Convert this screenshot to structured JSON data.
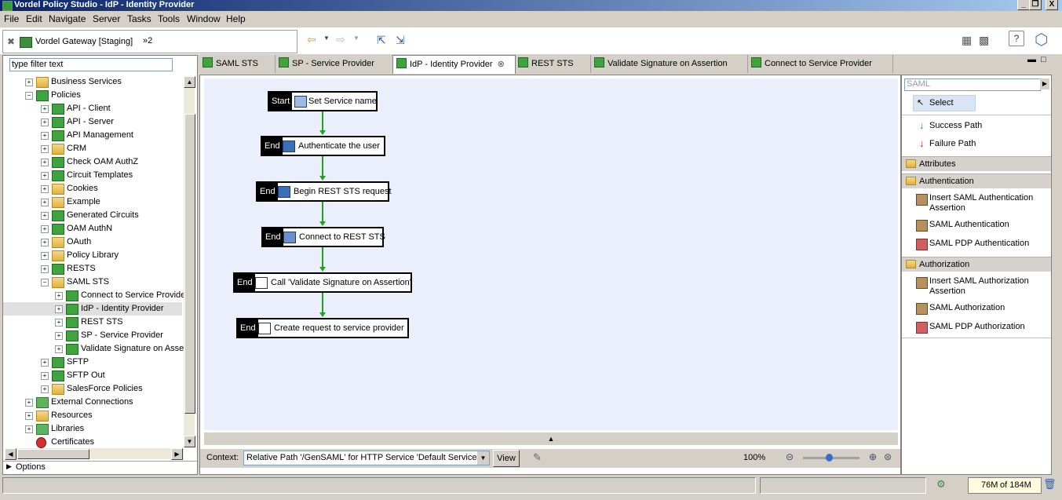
{
  "window": {
    "title": "Vordel Policy Studio - IdP - Identity Provider",
    "controls": [
      "_",
      "❐",
      "X"
    ]
  },
  "menu": [
    "File",
    "Edit",
    "Navigate",
    "Server",
    "Tasks",
    "Tools",
    "Window",
    "Help"
  ],
  "toolbar": {
    "gateway_label": "Vordel Gateway [Staging]",
    "gateway_suffix": "»2"
  },
  "tree": {
    "filter_placeholder": "type filter text",
    "rows": [
      {
        "label": "Business Services",
        "level": 1,
        "icon": "folder-icon"
      },
      {
        "label": "Policies",
        "level": 1,
        "icon": "policy-icon",
        "expanded": true
      },
      {
        "label": "API - Client",
        "level": 2,
        "icon": "policy-icon"
      },
      {
        "label": "API - Server",
        "level": 2,
        "icon": "policy-icon"
      },
      {
        "label": "API Management",
        "level": 2,
        "icon": "policy-icon"
      },
      {
        "label": "CRM",
        "level": 2,
        "icon": "folder-icon"
      },
      {
        "label": "Check OAM AuthZ",
        "level": 2,
        "icon": "policy-icon"
      },
      {
        "label": "Circuit Templates",
        "level": 2,
        "icon": "policy-icon"
      },
      {
        "label": "Cookies",
        "level": 2,
        "icon": "folder-icon"
      },
      {
        "label": "Example",
        "level": 2,
        "icon": "folder-icon"
      },
      {
        "label": "Generated Circuits",
        "level": 2,
        "icon": "policy-icon"
      },
      {
        "label": "OAM AuthN",
        "level": 2,
        "icon": "policy-icon"
      },
      {
        "label": "OAuth",
        "level": 2,
        "icon": "folder-icon"
      },
      {
        "label": "Policy Library",
        "level": 2,
        "icon": "folder-icon"
      },
      {
        "label": "RESTS",
        "level": 2,
        "icon": "policy-icon"
      },
      {
        "label": "SAML STS",
        "level": 2,
        "icon": "folder-icon",
        "expanded": true
      },
      {
        "label": "Connect to Service Provide",
        "level": 3,
        "icon": "policy-icon"
      },
      {
        "label": "IdP - Identity Provider",
        "level": 3,
        "icon": "policy-icon",
        "selected": true
      },
      {
        "label": "REST STS",
        "level": 3,
        "icon": "policy-icon"
      },
      {
        "label": "SP - Service Provider",
        "level": 3,
        "icon": "policy-icon"
      },
      {
        "label": "Validate Signature on Asse",
        "level": 3,
        "icon": "policy-icon"
      },
      {
        "label": "SFTP",
        "level": 2,
        "icon": "policy-icon"
      },
      {
        "label": "SFTP Out",
        "level": 2,
        "icon": "policy-icon"
      },
      {
        "label": "SalesForce Policies",
        "level": 2,
        "icon": "folder-icon"
      },
      {
        "label": "External Connections",
        "level": 1,
        "icon": "connections-icon"
      },
      {
        "label": "Resources",
        "level": 1,
        "icon": "resources-icon"
      },
      {
        "label": "Libraries",
        "level": 1,
        "icon": "libraries-icon"
      },
      {
        "label": "Certificates",
        "level": 1,
        "icon": "certificate-icon"
      }
    ],
    "options_label": "Options"
  },
  "tabs": [
    {
      "label": "SAML STS"
    },
    {
      "label": "SP - Service Provider"
    },
    {
      "label": "IdP - Identity Provider",
      "active": true
    },
    {
      "label": "REST STS"
    },
    {
      "label": "Validate Signature on Assertion"
    },
    {
      "label": "Connect to Service Provider"
    }
  ],
  "policy_nodes": [
    {
      "tag": "Start",
      "text": "Set Service name"
    },
    {
      "tag": "End",
      "text": "Authenticate the user"
    },
    {
      "tag": "End",
      "text": "Begin REST STS request"
    },
    {
      "tag": "End",
      "text": "Connect to REST STS"
    },
    {
      "tag": "End",
      "text": "Call 'Validate Signature on Assertion'"
    },
    {
      "tag": "End",
      "text": "Create request to service provider"
    }
  ],
  "context": {
    "label": "Context:",
    "value": "Relative Path '/GenSAML' for HTTP Service 'Default Services'",
    "view_button": "View",
    "zoom": "100%"
  },
  "palette": {
    "search_value": "SAML",
    "select_label": "Select",
    "success_path": "Success Path",
    "failure_path": "Failure Path",
    "groups": [
      {
        "name": "Attributes",
        "items": []
      },
      {
        "name": "Authentication",
        "items": [
          "Insert SAML Authentication Assertion",
          "SAML Authentication",
          "SAML PDP Authentication"
        ]
      },
      {
        "name": "Authorization",
        "items": [
          "Insert SAML Authorization Assertion",
          "SAML Authorization",
          "SAML PDP Authorization"
        ]
      }
    ]
  },
  "status": {
    "memory_used": "76M",
    "memory_of": "of 184M"
  },
  "colors": {
    "success_arrow": "#22a022",
    "failure_arrow": "#c02020",
    "canvas_bg": "#eaeffb",
    "node_tag_bg": "#000000"
  }
}
